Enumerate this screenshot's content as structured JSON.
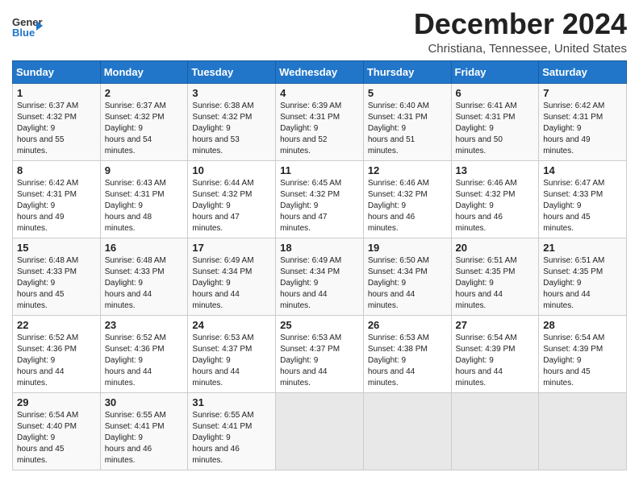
{
  "header": {
    "logo_general": "General",
    "logo_blue": "Blue",
    "title": "December 2024",
    "location": "Christiana, Tennessee, United States"
  },
  "days_of_week": [
    "Sunday",
    "Monday",
    "Tuesday",
    "Wednesday",
    "Thursday",
    "Friday",
    "Saturday"
  ],
  "weeks": [
    [
      {
        "day": 1,
        "sunrise": "6:37 AM",
        "sunset": "4:32 PM",
        "daylight": "9 hours and 55 minutes."
      },
      {
        "day": 2,
        "sunrise": "6:37 AM",
        "sunset": "4:32 PM",
        "daylight": "9 hours and 54 minutes."
      },
      {
        "day": 3,
        "sunrise": "6:38 AM",
        "sunset": "4:32 PM",
        "daylight": "9 hours and 53 minutes."
      },
      {
        "day": 4,
        "sunrise": "6:39 AM",
        "sunset": "4:31 PM",
        "daylight": "9 hours and 52 minutes."
      },
      {
        "day": 5,
        "sunrise": "6:40 AM",
        "sunset": "4:31 PM",
        "daylight": "9 hours and 51 minutes."
      },
      {
        "day": 6,
        "sunrise": "6:41 AM",
        "sunset": "4:31 PM",
        "daylight": "9 hours and 50 minutes."
      },
      {
        "day": 7,
        "sunrise": "6:42 AM",
        "sunset": "4:31 PM",
        "daylight": "9 hours and 49 minutes."
      }
    ],
    [
      {
        "day": 8,
        "sunrise": "6:42 AM",
        "sunset": "4:31 PM",
        "daylight": "9 hours and 49 minutes."
      },
      {
        "day": 9,
        "sunrise": "6:43 AM",
        "sunset": "4:31 PM",
        "daylight": "9 hours and 48 minutes."
      },
      {
        "day": 10,
        "sunrise": "6:44 AM",
        "sunset": "4:32 PM",
        "daylight": "9 hours and 47 minutes."
      },
      {
        "day": 11,
        "sunrise": "6:45 AM",
        "sunset": "4:32 PM",
        "daylight": "9 hours and 47 minutes."
      },
      {
        "day": 12,
        "sunrise": "6:46 AM",
        "sunset": "4:32 PM",
        "daylight": "9 hours and 46 minutes."
      },
      {
        "day": 13,
        "sunrise": "6:46 AM",
        "sunset": "4:32 PM",
        "daylight": "9 hours and 46 minutes."
      },
      {
        "day": 14,
        "sunrise": "6:47 AM",
        "sunset": "4:33 PM",
        "daylight": "9 hours and 45 minutes."
      }
    ],
    [
      {
        "day": 15,
        "sunrise": "6:48 AM",
        "sunset": "4:33 PM",
        "daylight": "9 hours and 45 minutes."
      },
      {
        "day": 16,
        "sunrise": "6:48 AM",
        "sunset": "4:33 PM",
        "daylight": "9 hours and 44 minutes."
      },
      {
        "day": 17,
        "sunrise": "6:49 AM",
        "sunset": "4:34 PM",
        "daylight": "9 hours and 44 minutes."
      },
      {
        "day": 18,
        "sunrise": "6:49 AM",
        "sunset": "4:34 PM",
        "daylight": "9 hours and 44 minutes."
      },
      {
        "day": 19,
        "sunrise": "6:50 AM",
        "sunset": "4:34 PM",
        "daylight": "9 hours and 44 minutes."
      },
      {
        "day": 20,
        "sunrise": "6:51 AM",
        "sunset": "4:35 PM",
        "daylight": "9 hours and 44 minutes."
      },
      {
        "day": 21,
        "sunrise": "6:51 AM",
        "sunset": "4:35 PM",
        "daylight": "9 hours and 44 minutes."
      }
    ],
    [
      {
        "day": 22,
        "sunrise": "6:52 AM",
        "sunset": "4:36 PM",
        "daylight": "9 hours and 44 minutes."
      },
      {
        "day": 23,
        "sunrise": "6:52 AM",
        "sunset": "4:36 PM",
        "daylight": "9 hours and 44 minutes."
      },
      {
        "day": 24,
        "sunrise": "6:53 AM",
        "sunset": "4:37 PM",
        "daylight": "9 hours and 44 minutes."
      },
      {
        "day": 25,
        "sunrise": "6:53 AM",
        "sunset": "4:37 PM",
        "daylight": "9 hours and 44 minutes."
      },
      {
        "day": 26,
        "sunrise": "6:53 AM",
        "sunset": "4:38 PM",
        "daylight": "9 hours and 44 minutes."
      },
      {
        "day": 27,
        "sunrise": "6:54 AM",
        "sunset": "4:39 PM",
        "daylight": "9 hours and 44 minutes."
      },
      {
        "day": 28,
        "sunrise": "6:54 AM",
        "sunset": "4:39 PM",
        "daylight": "9 hours and 45 minutes."
      }
    ],
    [
      {
        "day": 29,
        "sunrise": "6:54 AM",
        "sunset": "4:40 PM",
        "daylight": "9 hours and 45 minutes."
      },
      {
        "day": 30,
        "sunrise": "6:55 AM",
        "sunset": "4:41 PM",
        "daylight": "9 hours and 46 minutes."
      },
      {
        "day": 31,
        "sunrise": "6:55 AM",
        "sunset": "4:41 PM",
        "daylight": "9 hours and 46 minutes."
      },
      null,
      null,
      null,
      null
    ]
  ]
}
